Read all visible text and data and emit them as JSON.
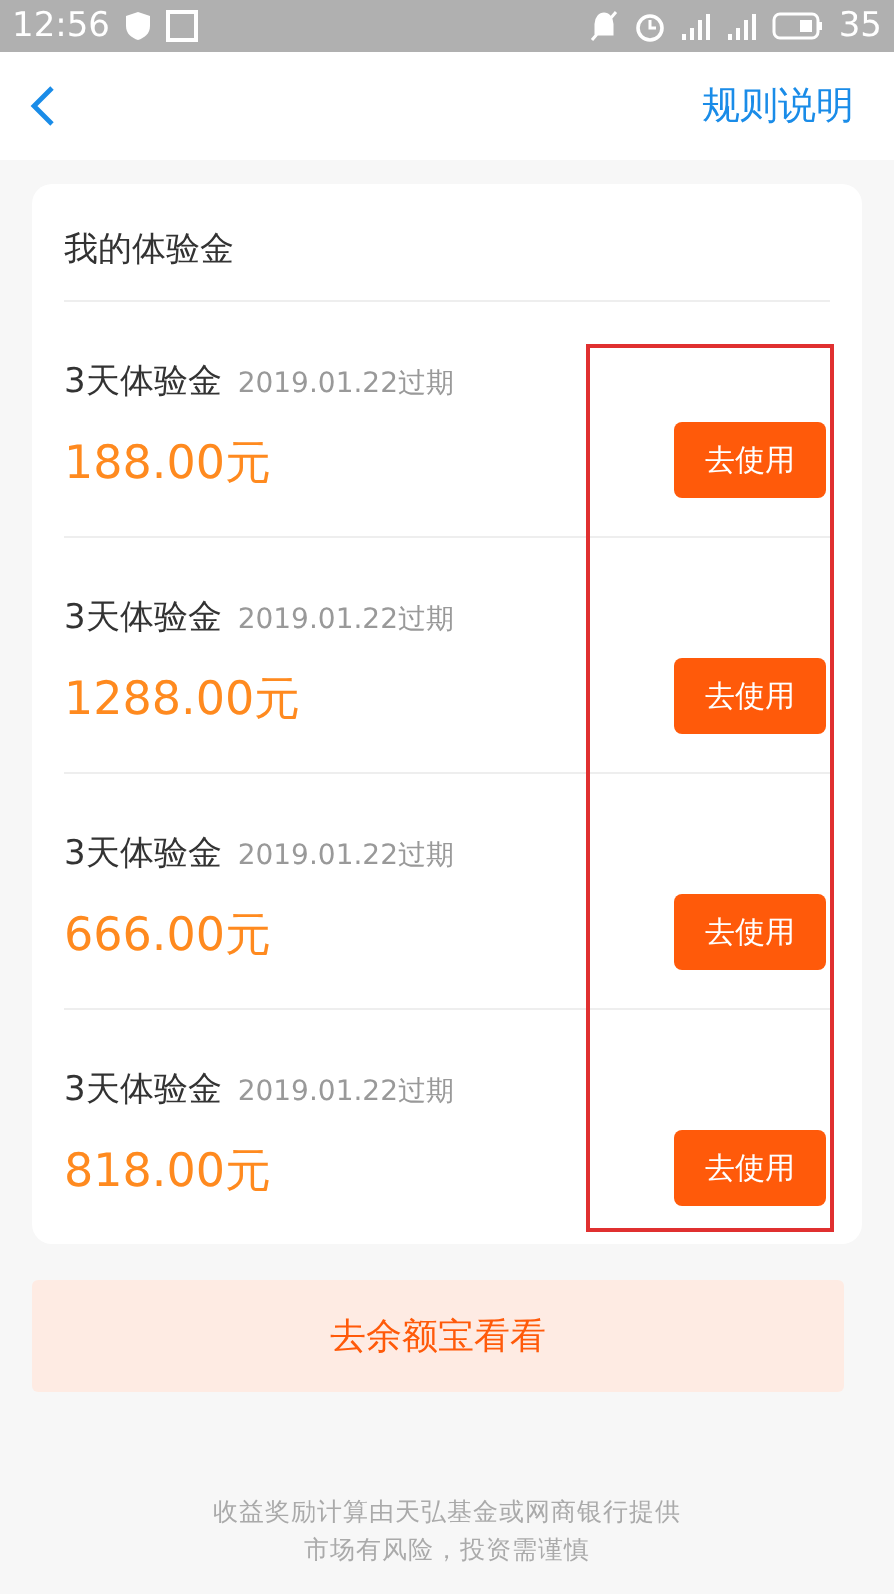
{
  "status_bar": {
    "time": "12:56",
    "battery": "35"
  },
  "nav": {
    "action": "规则说明"
  },
  "card": {
    "title": "我的体验金",
    "items": [
      {
        "name": "3天体验金",
        "expiry": "2019.01.22过期",
        "amount": "188.00元",
        "button": "去使用"
      },
      {
        "name": "3天体验金",
        "expiry": "2019.01.22过期",
        "amount": "1288.00元",
        "button": "去使用"
      },
      {
        "name": "3天体验金",
        "expiry": "2019.01.22过期",
        "amount": "666.00元",
        "button": "去使用"
      },
      {
        "name": "3天体验金",
        "expiry": "2019.01.22过期",
        "amount": "818.00元",
        "button": "去使用"
      }
    ]
  },
  "bottom_button": "去余额宝看看",
  "footer": [
    "收益奖励计算由天弘基金或网商银行提供",
    "市场有风险，投资需谨慎"
  ]
}
